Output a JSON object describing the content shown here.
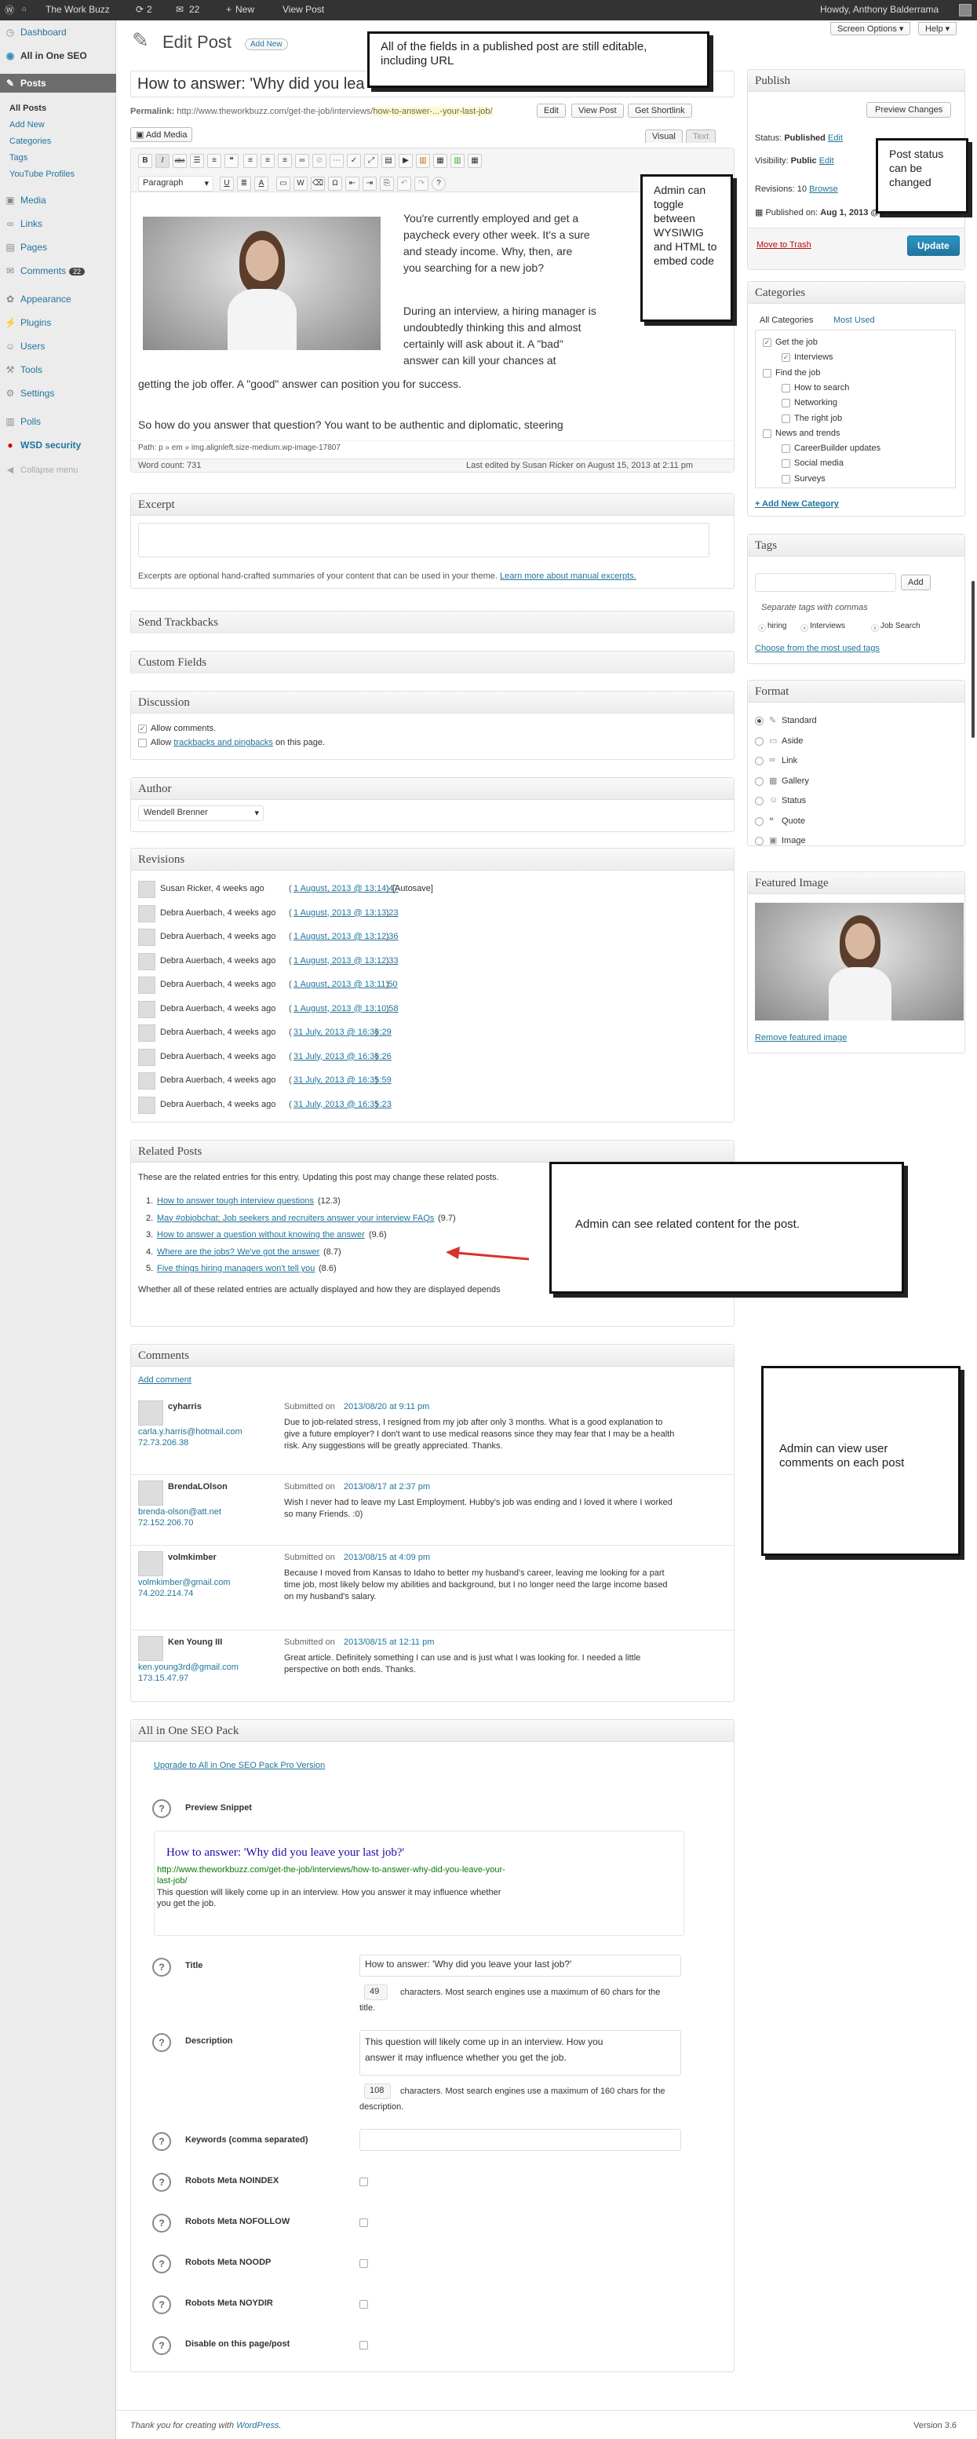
{
  "admin_bar": {
    "site": "The Work Buzz",
    "updates": "2",
    "comments": "22",
    "new": "New",
    "view_post": "View Post",
    "howdy": "Howdy, Anthony Balderrama"
  },
  "screen_meta": {
    "screen_options": "Screen Options",
    "help": "Help"
  },
  "menu": {
    "dashboard": "Dashboard",
    "seo": "All in One SEO",
    "posts": "Posts",
    "posts_sub": [
      "All Posts",
      "Add New",
      "Categories",
      "Tags",
      "YouTube Profiles"
    ],
    "media": "Media",
    "links": "Links",
    "pages": "Pages",
    "comments": "Comments",
    "comments_count": "22",
    "appearance": "Appearance",
    "plugins": "Plugins",
    "users": "Users",
    "tools": "Tools",
    "settings": "Settings",
    "polls": "Polls",
    "wsd": "WSD security",
    "collapse": "Collapse menu"
  },
  "page": {
    "title": "Edit Post",
    "add_new": "Add New"
  },
  "post": {
    "title": "How to answer: 'Why did you lea",
    "permalink_label": "Permalink:",
    "permalink_base": "http://www.theworkbuzz.com/get-the-job/interviews/",
    "permalink_slug": "how-to-answer-...-your-last-job/",
    "edit": "Edit",
    "view_post": "View Post",
    "get_shortlink": "Get Shortlink",
    "add_media": "Add Media",
    "tab_visual": "Visual",
    "tab_text": "Text",
    "format_select": "Paragraph"
  },
  "content": {
    "p1": "You're currently employed and get a paycheck every other week. It's a sure and steady income. Why, then, are you searching for a new job?",
    "p2a": "During an interview, a hiring manager is undoubtedly thinking this and almost certainly will ask about it. A \"bad\" answer can kill your chances at",
    "p2b": "getting the job offer. A \"good\" answer can position you for success.",
    "p3": "So how do you answer that question? You want to be authentic and diplomatic, steering",
    "path": "Path: p » em » img.alignleft.size-medium.wp-image-17807",
    "word_count": "Word count: 731",
    "last_edited": "Last edited by Susan Ricker on August 15, 2013 at 2:11 pm"
  },
  "excerpt": {
    "title": "Excerpt",
    "note": "Excerpts are optional hand-crafted summaries of your content that can be used in your theme.",
    "link": "Learn more about manual excerpts."
  },
  "trackbacks": {
    "title": "Send Trackbacks"
  },
  "custom_fields": {
    "title": "Custom Fields"
  },
  "discussion": {
    "title": "Discussion",
    "allow_comments": "Allow comments.",
    "allow": "Allow",
    "trackbacks_link": "trackbacks and pingbacks",
    "on_page": "on this page."
  },
  "author": {
    "title": "Author",
    "value": "Wendell Brenner"
  },
  "revisions": {
    "title": "Revisions",
    "items": [
      {
        "who": "Susan Ricker, 4 weeks ago",
        "date": "1 August, 2013 @ 13:14:47",
        "suffix": "[Autosave]"
      },
      {
        "who": "Debra Auerbach, 4 weeks ago",
        "date": "1 August, 2013 @ 13:13:23",
        "suffix": ""
      },
      {
        "who": "Debra Auerbach, 4 weeks ago",
        "date": "1 August, 2013 @ 13:12:36",
        "suffix": ""
      },
      {
        "who": "Debra Auerbach, 4 weeks ago",
        "date": "1 August, 2013 @ 13:12:33",
        "suffix": ""
      },
      {
        "who": "Debra Auerbach, 4 weeks ago",
        "date": "1 August, 2013 @ 13:11:50",
        "suffix": ""
      },
      {
        "who": "Debra Auerbach, 4 weeks ago",
        "date": "1 August, 2013 @ 13:10:58",
        "suffix": ""
      },
      {
        "who": "Debra Auerbach, 4 weeks ago",
        "date": "31 July, 2013 @ 16:36:29",
        "suffix": ""
      },
      {
        "who": "Debra Auerbach, 4 weeks ago",
        "date": "31 July, 2013 @ 16:36:26",
        "suffix": ""
      },
      {
        "who": "Debra Auerbach, 4 weeks ago",
        "date": "31 July, 2013 @ 16:35:59",
        "suffix": ""
      },
      {
        "who": "Debra Auerbach, 4 weeks ago",
        "date": "31 July, 2013 @ 16:35:23",
        "suffix": ""
      }
    ]
  },
  "related": {
    "title": "Related Posts",
    "intro": "These are the related entries for this entry. Updating this post may change these related posts.",
    "items": [
      {
        "n": "1.",
        "link": "How to answer tough interview questions",
        "score": "(12.3)"
      },
      {
        "n": "2.",
        "link": "May #objobchat: Job seekers and recruiters answer your interview FAQs",
        "score": "(9.7)"
      },
      {
        "n": "3.",
        "link": "How to answer a question without knowing the answer",
        "score": "(9.6)"
      },
      {
        "n": "4.",
        "link": "Where are the jobs? We've got the answer",
        "score": "(8.7)"
      },
      {
        "n": "5.",
        "link": "Five things hiring managers won't tell you",
        "score": "(8.6)"
      }
    ],
    "outro": "Whether all of these related entries are actually displayed and how they are displayed depends"
  },
  "comments": {
    "title": "Comments",
    "add": "Add comment",
    "items": [
      {
        "name": "cyharris",
        "email": "carla.y.harris@hotmail.com",
        "ip": "72.73.206.38",
        "submitted": "Submitted on",
        "date": "2013/08/20 at 9:11 pm",
        "text1": "Due to job-related stress, I resigned from my job after only 3 months.  What is a good explanation to",
        "text2": "give a future employer?  I don't want to use medical reasons since they may fear that I may be a health",
        "text3": "risk.  Any suggestions will be greatly appreciated.  Thanks."
      },
      {
        "name": "BrendaLOlson",
        "email": "brenda-olson@att.net",
        "ip": "72.152.206.70",
        "submitted": "Submitted on",
        "date": "2013/08/17 at 2:37 pm",
        "text1": "Wish I never had to leave my Last Employment. Hubby's job was ending and I loved it where I worked",
        "text2": "so many Friends. :0)",
        "text3": ""
      },
      {
        "name": "volmkimber",
        "email": "volmkimber@gmail.com",
        "ip": "74.202.214.74",
        "submitted": "Submitted on",
        "date": "2013/08/15 at 4:09 pm",
        "text1": "Because I moved from Kansas to Idaho to better my husband's career, leaving me looking for a part",
        "text2": "time job, most likely below my abilities and background, but I no longer need the large income based",
        "text3": "on my husband's salary."
      },
      {
        "name": "Ken Young III",
        "email": "ken.young3rd@gmail.com",
        "ip": "173.15.47.97",
        "submitted": "Submitted on",
        "date": "2013/08/15 at 12:11 pm",
        "text1": "Great article.  Definitely something I can use and is just what I was looking for.  I needed a little",
        "text2": "perspective on both ends.  Thanks.",
        "text3": ""
      }
    ]
  },
  "seo": {
    "title": "All in One SEO Pack",
    "upgrade": "Upgrade to All in One SEO Pack Pro Version",
    "preview_label": "Preview Snippet",
    "snippet_title": "How to answer: 'Why did you leave your last job?'",
    "snippet_url1": "http://www.theworkbuzz.com/get-the-job/interviews/how-to-answer-why-did-you-leave-your-",
    "snippet_url2": "last-job/",
    "snippet_desc1": "This question will likely come up in an interview. How you answer it may influence whether",
    "snippet_desc2": "you get the job.",
    "title_label": "Title",
    "title_value": "How to answer: 'Why did you leave your last job?'",
    "title_count": "49",
    "title_note1": "characters. Most search engines use a maximum of 60 chars for the",
    "title_note2": "title.",
    "desc_label": "Description",
    "desc_value1": "This question will likely come up in an interview. How you",
    "desc_value2": "answer it may influence whether you get the job.",
    "desc_count": "108",
    "desc_note1": "characters. Most search engines use a maximum of 160 chars for the",
    "desc_note2": "description.",
    "keywords_label": "Keywords (comma separated)",
    "noindex": "Robots Meta NOINDEX",
    "nofollow": "Robots Meta NOFOLLOW",
    "noodp": "Robots Meta NOODP",
    "noydir": "Robots Meta NOYDIR",
    "disable": "Disable on this page/post"
  },
  "publish": {
    "title": "Publish",
    "preview": "Preview Changes",
    "status_label": "Status:",
    "status": "Published",
    "status_edit": "Edit",
    "visibility_label": "Visibility:",
    "visibility": "Public",
    "visibility_edit": "Edit",
    "revisions_label": "Revisions: 10",
    "revisions_browse": "Browse",
    "published_on_label": "Published on:",
    "published_on": "Aug 1, 2013 @ 13:14",
    "trash": "Move to Trash",
    "update": "Update"
  },
  "categories": {
    "title": "Categories",
    "tab_all": "All Categories",
    "tab_used": "Most Used",
    "items": [
      {
        "label": "Get the job",
        "checked": "✓",
        "indent": 0
      },
      {
        "label": "Interviews",
        "checked": "✓",
        "indent": 1
      },
      {
        "label": "Find the job",
        "checked": "",
        "indent": 0
      },
      {
        "label": "How to search",
        "checked": "",
        "indent": 1
      },
      {
        "label": "Networking",
        "checked": "",
        "indent": 1
      },
      {
        "label": "The right job",
        "checked": "",
        "indent": 1
      },
      {
        "label": "News and trends",
        "checked": "",
        "indent": 0
      },
      {
        "label": "CareerBuilder updates",
        "checked": "",
        "indent": 1
      },
      {
        "label": "Social media",
        "checked": "",
        "indent": 1
      },
      {
        "label": "Surveys",
        "checked": "",
        "indent": 1
      }
    ],
    "add": "+ Add New Category"
  },
  "tags": {
    "title": "Tags",
    "add": "Add",
    "note": "Separate tags with commas",
    "items": [
      "hiring",
      "Interviews",
      "Job Search"
    ],
    "choose": "Choose from the most used tags"
  },
  "format": {
    "title": "Format",
    "items": [
      "Standard",
      "Aside",
      "Link",
      "Gallery",
      "Status",
      "Quote",
      "Image"
    ]
  },
  "featured": {
    "title": "Featured Image",
    "remove": "Remove featured image"
  },
  "callouts": {
    "c1": "All of the fields in a published post are still editable, including URL",
    "c2": "Admin can toggle between WYSIWIG and HTML to embed code",
    "c3": "Post status can be changed",
    "c4": "Admin can see related content for the post.",
    "c5": "Admin can view user comments on each post"
  },
  "footer": {
    "thanks": "Thank you for creating with",
    "wp": "WordPress.",
    "version": "Version 3.6"
  },
  "colors": {
    "accent": "#21759b",
    "adminbar": "#333333",
    "trash": "#bc0b0b",
    "arrow": "#d9302a"
  }
}
